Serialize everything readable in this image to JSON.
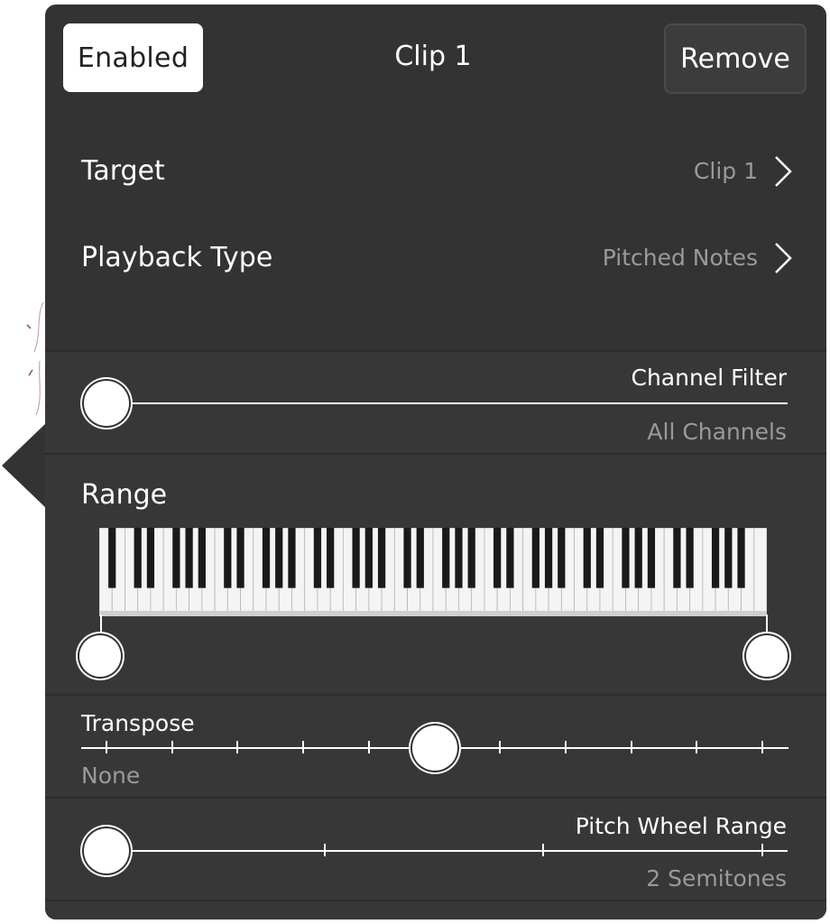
{
  "header": {
    "enabled_label": "Enabled",
    "title": "Clip 1",
    "remove_label": "Remove"
  },
  "settings": {
    "target_label": "Target",
    "target_value": "Clip 1",
    "playback_label": "Playback Type",
    "playback_value": "Pitched Notes"
  },
  "channel_filter": {
    "label": "Channel Filter",
    "value": "All Channels",
    "position": 0
  },
  "range": {
    "label": "Range",
    "low": 0,
    "high": 1
  },
  "transpose": {
    "label": "Transpose",
    "value": "None",
    "position": 0.5
  },
  "pitch_wheel": {
    "label": "Pitch Wheel Range",
    "value": "2 Semitones",
    "position": 0
  },
  "icons": {
    "chevron": "chevron-right-icon"
  },
  "colors": {
    "panel": "#333333",
    "section": "#373737",
    "text": "#ffffff",
    "muted": "#9a9a9a"
  }
}
